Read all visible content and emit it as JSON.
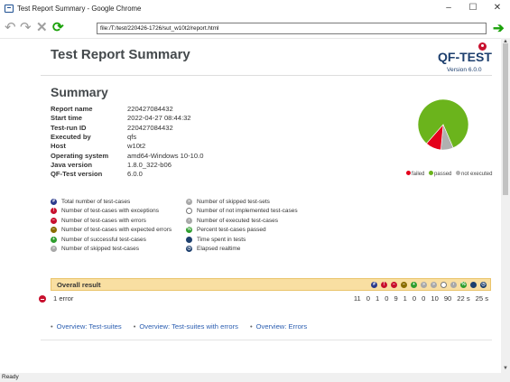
{
  "window": {
    "title": "Test Report Summary - Google Chrome",
    "minimize": "–",
    "maximize": "☐",
    "close": "✕"
  },
  "toolbar": {
    "url": "file:/T:/test/220426-1726/sut_w10t2/report.html"
  },
  "status": "Ready",
  "report": {
    "title": "Test Report Summary",
    "logo": "QF-TEST",
    "version": "Version 6.0.0",
    "summary_title": "Summary",
    "fields": [
      {
        "label": "Report name",
        "value": "220427084432"
      },
      {
        "label": "Start time",
        "value": "2022-04-27 08:44:32"
      },
      {
        "label": "Test-run ID",
        "value": "220427084432"
      },
      {
        "label": "Executed by",
        "value": "qfs"
      },
      {
        "label": "Host",
        "value": "w10t2"
      },
      {
        "label": "Operating system",
        "value": "amd64-Windows 10-10.0"
      },
      {
        "label": "Java version",
        "value": "1.8.0_322-b06"
      },
      {
        "label": "QF-Test version",
        "value": "6.0.0"
      }
    ],
    "pie_legend": {
      "failed": "failed",
      "passed": "passed",
      "not_executed": "not executed"
    },
    "pie_colors": {
      "failed": "#e4001b",
      "passed": "#6bb41c",
      "not_executed": "#b0b0b0"
    },
    "pie_fractions": {
      "failed": 0.1,
      "passed": 0.82,
      "not_executed": 0.08
    },
    "legend_left": [
      {
        "icon": "total-icon",
        "text": "Total number of test-cases"
      },
      {
        "icon": "exception-icon",
        "text": "Number of test-cases with exceptions"
      },
      {
        "icon": "error-icon",
        "text": "Number of test-cases with errors"
      },
      {
        "icon": "expected-error-icon",
        "text": "Number of test-cases with expected errors"
      },
      {
        "icon": "success-icon",
        "text": "Number of successful test-cases"
      },
      {
        "icon": "skipped-icon",
        "text": "Number of skipped test-cases"
      }
    ],
    "legend_right": [
      {
        "icon": "skipped-sets-icon",
        "text": "Number of skipped test-sets"
      },
      {
        "icon": "not-implemented-icon",
        "text": "Number of not implemented test-cases"
      },
      {
        "icon": "executed-icon",
        "text": "Number of executed test-cases"
      },
      {
        "icon": "percent-icon",
        "text": "Percent test-cases passed"
      },
      {
        "icon": "time-icon",
        "text": "Time spent in tests"
      },
      {
        "icon": "realtime-icon",
        "text": "Elapsed realtime"
      }
    ],
    "overall_label": "Overall result",
    "error_text": "1 error",
    "counts": [
      "11",
      "0",
      "1",
      "0",
      "9",
      "1",
      "0",
      "0",
      "10",
      "90",
      "22 s",
      "25 s"
    ],
    "links": [
      "Overview: Test-suites",
      "Overview: Test-suites with errors",
      "Overview: Errors"
    ],
    "bullet": "•"
  }
}
